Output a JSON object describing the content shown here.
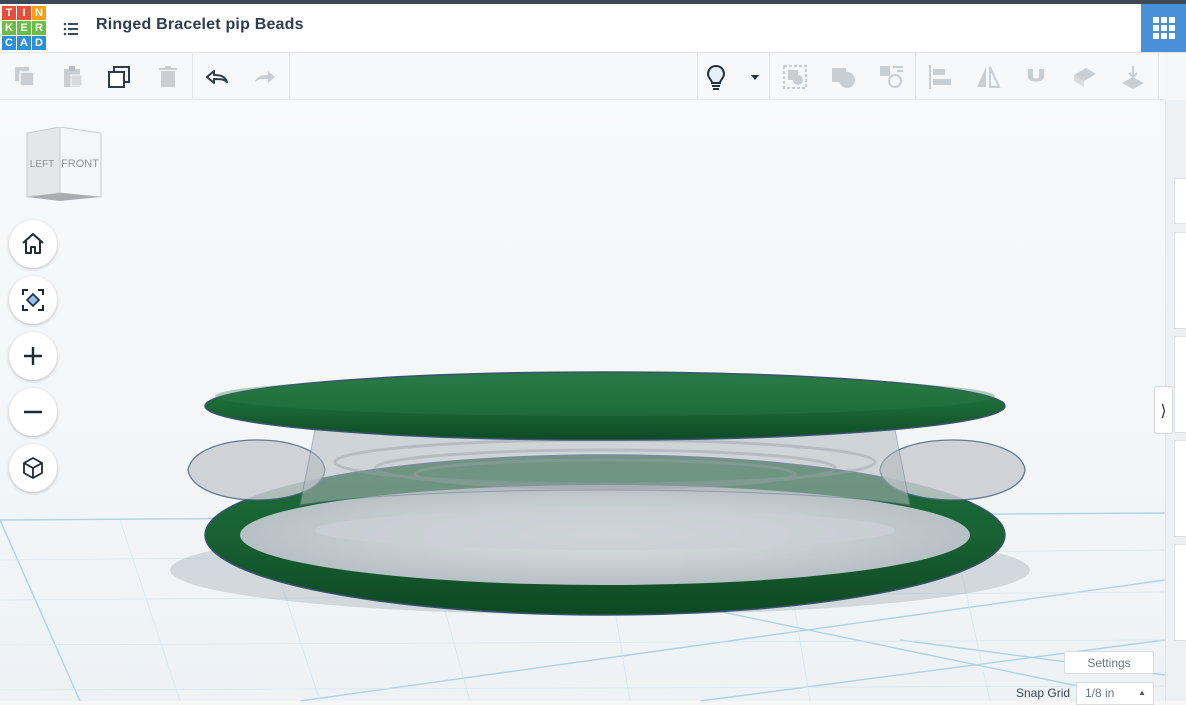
{
  "app": {
    "logo_letters": [
      "T",
      "I",
      "N",
      "K",
      "E",
      "R",
      "C",
      "A",
      "D"
    ],
    "logo_colors": [
      "#e94e3d",
      "#e94e3d",
      "#f6a01a",
      "#6cbd45",
      "#6cbd45",
      "#6cbd45",
      "#2d8fd5",
      "#2d8fd5",
      "#2d8fd5"
    ],
    "title": "Ringed Bracelet pip Beads"
  },
  "toolbar": {
    "left_icons": [
      "copy-icon",
      "paste-icon",
      "duplicate-icon",
      "delete-icon",
      "undo-icon",
      "redo-icon"
    ],
    "right_icons": [
      "bulb-icon",
      "dropdown-icon",
      "group-icon",
      "ungroup-icon",
      "hole-icon",
      "align-icon",
      "mirror-icon",
      "magnet-icon",
      "workplane-icon",
      "ruler-icon"
    ]
  },
  "viewcube": {
    "left_label": "LEFT",
    "front_label": "FRONT"
  },
  "nav_buttons": [
    "home-icon",
    "fit-view-icon",
    "zoom-in-icon",
    "zoom-out-icon",
    "ortho-view-icon"
  ],
  "bottom": {
    "settings_label": "Settings",
    "snap_label": "Snap Grid",
    "snap_value": "1/8 in"
  },
  "colors": {
    "shape_green": "#1b6a36",
    "hole_gray": "#c8cdd2",
    "accent": "#4a90d9"
  }
}
